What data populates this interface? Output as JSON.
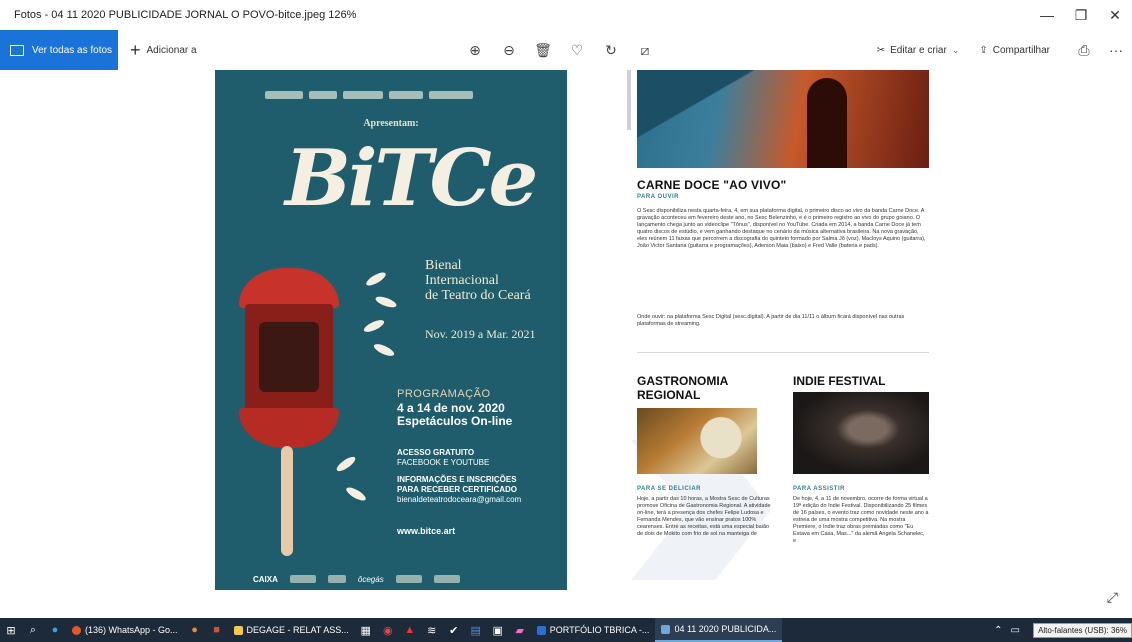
{
  "window": {
    "title": "Fotos - 04 11 2020 PUBLICIDADE JORNAL O POVO-bitce.jpeg   126%",
    "minimize": "—",
    "restore": "❐",
    "close": "✕"
  },
  "toolbar": {
    "view_all_label": "Ver todas as fotos",
    "add_label": "Adicionar a",
    "zoom_in": "⊕",
    "zoom_out": "⊖",
    "delete": "🗑",
    "favorite": "♡",
    "rotate": "↻",
    "crop": "⧄",
    "edit_label": "Editar e criar",
    "edit_chevron": "⌄",
    "share_label": "Compartilhar",
    "print": "⎙",
    "more": "···"
  },
  "poster": {
    "presents": "Apresentam:",
    "logo": "BiTCe",
    "bienal_line1": "Bienal",
    "bienal_line2": "Internacional",
    "bienal_line3": "de Teatro do Ceará",
    "dates": "Nov. 2019 a Mar. 2021",
    "programacao": "PROGRAMAÇÃO",
    "prog_line1": "4 a 14 de nov. 2020",
    "prog_line2": "Espetáculos On-line",
    "acesso_line1": "ACESSO GRATUITO",
    "acesso_line2": "FACEBOOK E YOUTUBE",
    "insc_line1": "INFORMAÇÕES E INSCRIÇÕES",
    "insc_line2": "PARA RECEBER CERTIFICADO",
    "insc_email": "bienaldeteatrodoceara@gmail.com",
    "site": "www.bitce.art",
    "sponsor_caixa": "CAIXA",
    "sponsor_cegas": "ôcegás"
  },
  "newspaper": {
    "carne_title": "CARNE DOCE \"AO VIVO\"",
    "carne_tag": "PARA OUVIR",
    "carne_body": "O Sesc disponibiliza nesta quarta-feira, 4, em sua plataforma digital, o primeiro disco ao vivo da banda Carne Doce. A gravação aconteceu em fevereiro deste ano, no Sesc Belenzinho, e é o primeiro registro ao vivo do grupo goiano. O lançamento chega junto ao videoclipe \"Tônus\", disponível no YouTube. Criada em 2014, a banda Carne Doce já tem quatro discos de estúdio, e vem ganhando destaque no cenário da música alternativa brasileira. Na nova gravação, eles reúnem 11 faixas que percorrem a discografia do quinteto formado por Salma Jô (voz), Macloys Aquino (guitarra), João Victor Santana (guitarra e programações), Aderson Maia (baixo) e Fred Valle (bateria e pads).",
    "carne_where": "Onde ouvir: na plataforma Sesc Digital (sesc.digital). A partir de dia 11/11 o álbum ficará disponível nas outras plataformas de streaming.",
    "gastro_title_1": "GASTRONOMIA",
    "gastro_title_2": "REGIONAL",
    "gastro_tag": "PARA SE DELICIAR",
    "gastro_body": "Hoje, a partir das 10 horas, a Mostra Sesc de Culturas promove Oficina de Gastronomia Regional. A atividade on-line, terá a presença dos chefes Felipe Ludosa e Fernanda Mendes, que vão ensinar pratos 100% cearenses. Entre as receitas, está uma especial baião de dois de Mokito com frio de sol na manteiga de",
    "indie_title": "INDIE FESTIVAL",
    "indie_tag": "PARA ASSISTIR",
    "indie_body": "De hoje, 4, a 11 de novembro, ocorre de forma virtual a 19ª edição do Indie Festival. Disponibilizando 25 filmes de 16 países, o evento traz como novidade neste ano a estreia de uma mostra competitiva. Na mostra Premiere, o Indie traz obras premiadas como \"Eu Estava em Casa, Mas...\" da alemã Angela Schanelec, e"
  },
  "taskbar": {
    "whatsapp": "(136) WhatsApp - Go...",
    "degage": "DEGAGE - RELAT ASS...",
    "portfolio": "PORTFÓLIO TBRICA -...",
    "photo": "04 11 2020 PUBLICIDA...",
    "tooltip": "Alto-falantes (USB): 36%"
  },
  "colors": {
    "accent": "#1a73d8",
    "poster_bg": "#1f5d6d",
    "taskbar_bg": "#1c2a3a",
    "tag_color": "#2f7f95"
  }
}
